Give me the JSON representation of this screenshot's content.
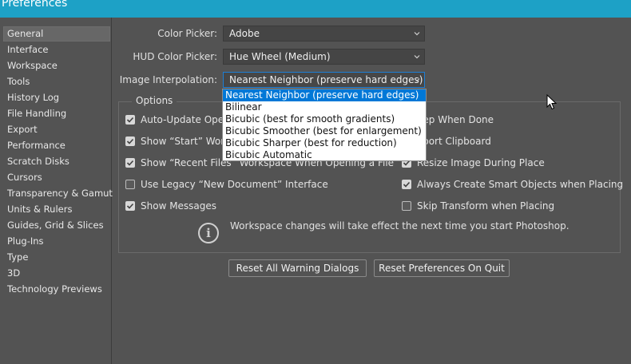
{
  "window": {
    "title": "Preferences"
  },
  "sidebar": {
    "items": [
      {
        "label": "General",
        "active": true
      },
      {
        "label": "Interface"
      },
      {
        "label": "Workspace"
      },
      {
        "label": "Tools"
      },
      {
        "label": "History Log"
      },
      {
        "label": "File Handling"
      },
      {
        "label": "Export"
      },
      {
        "label": "Performance"
      },
      {
        "label": "Scratch Disks"
      },
      {
        "label": "Cursors"
      },
      {
        "label": "Transparency & Gamut"
      },
      {
        "label": "Units & Rulers"
      },
      {
        "label": "Guides, Grid & Slices"
      },
      {
        "label": "Plug-Ins"
      },
      {
        "label": "Type"
      },
      {
        "label": "3D"
      },
      {
        "label": "Technology Previews"
      }
    ]
  },
  "general": {
    "color_picker": {
      "label": "Color Picker:",
      "value": "Adobe"
    },
    "hud_color_picker": {
      "label": "HUD Color Picker:",
      "value": "Hue Wheel (Medium)"
    },
    "image_interpolation": {
      "label": "Image Interpolation:",
      "value": "Nearest Neighbor (preserve hard edges)",
      "options": [
        "Nearest Neighbor (preserve hard edges)",
        "Bilinear",
        "Bicubic (best for smooth gradients)",
        "Bicubic Smoother (best for enlargement)",
        "Bicubic Sharper (best for reduction)",
        "Bicubic Automatic"
      ]
    }
  },
  "options": {
    "title": "Options",
    "left": [
      {
        "label": "Auto-Update Open Documents",
        "visible": "Auto-Update Oper",
        "checked": true
      },
      {
        "label": "Show “Start” Workspace When No Documents Are Open",
        "visible": "Show “Start” Work",
        "checked": true
      },
      {
        "label": "Show “Recent Files” Workspace When Opening a File",
        "checked": true
      },
      {
        "label": "Use Legacy “New Document” Interface",
        "checked": false
      },
      {
        "label": "Show Messages",
        "checked": true
      }
    ],
    "right": [
      {
        "label": "Beep When Done",
        "visible": "eep When Done",
        "checked": false
      },
      {
        "label": "Export Clipboard",
        "visible": "xport Clipboard",
        "checked": true
      },
      {
        "label": "Resize Image During Place",
        "checked": true
      },
      {
        "label": "Always Create Smart Objects when Placing",
        "checked": true
      },
      {
        "label": "Skip Transform when Placing",
        "checked": false
      }
    ],
    "info": "Workspace changes will take effect the next time you start Photoshop."
  },
  "buttons": {
    "reset_warnings": "Reset All Warning Dialogs",
    "reset_on_quit": "Reset Preferences On Quit"
  },
  "icons": {
    "chevron": "chevron-down-icon",
    "checkmark": "checkmark-icon",
    "info": "info-icon",
    "cursor": "mouse-pointer-icon"
  },
  "colors": {
    "titlebar": "#1da1c6",
    "panel": "#535353",
    "selection": "#0078d7"
  }
}
